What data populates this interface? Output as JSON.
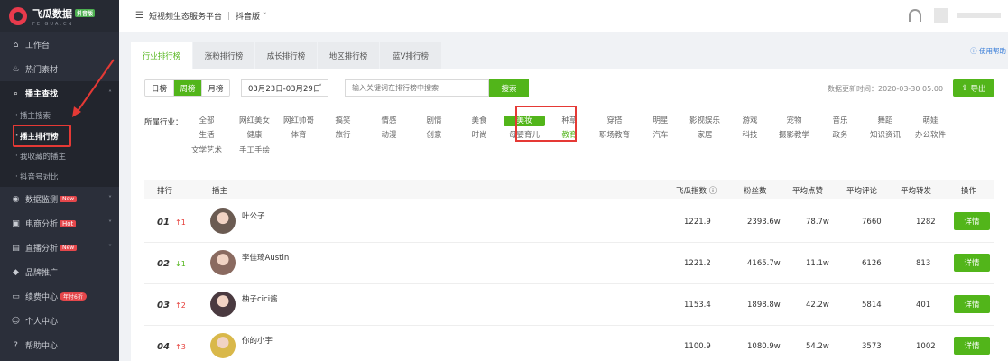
{
  "brand": {
    "name": "飞瓜数据",
    "badge": "抖音版",
    "sub": "FEIGUA.CN"
  },
  "sidebar": {
    "items": [
      {
        "label": "工作台",
        "icon": "home-icon"
      },
      {
        "label": "热门素材",
        "icon": "fire-icon"
      },
      {
        "label": "播主查找",
        "icon": "search-icon"
      },
      {
        "label": "数据监测",
        "icon": "monitor-icon",
        "tag": "New"
      },
      {
        "label": "电商分析",
        "icon": "cart-icon",
        "tag": "Hot"
      },
      {
        "label": "直播分析",
        "icon": "live-icon",
        "tag": "New"
      },
      {
        "label": "品牌推广",
        "icon": "diamond-icon"
      },
      {
        "label": "续费中心",
        "icon": "card-icon",
        "tag": "年付6折"
      },
      {
        "label": "个人中心",
        "icon": "user-icon"
      },
      {
        "label": "帮助中心",
        "icon": "help-icon"
      }
    ],
    "sub_items": [
      "播主搜索",
      "播主排行榜",
      "我收藏的播主",
      "抖音号对比"
    ]
  },
  "header": {
    "title": "短视频生态服务平台",
    "version": "抖音版"
  },
  "tabs": [
    "行业排行榜",
    "涨粉排行榜",
    "成长排行榜",
    "地区排行榜",
    "蓝V排行榜"
  ],
  "help_link": "使用帮助",
  "toolbar": {
    "periods": [
      "日榜",
      "周榜",
      "月榜"
    ],
    "date_range": "03月23日-03月29日",
    "search_placeholder": "输入关键词在排行榜中搜索",
    "search_label": "搜索",
    "update_time": "数据更新时间：2020-03-30 05:00",
    "export_label": "导出"
  },
  "industry": {
    "label": "所属行业：",
    "rows": [
      [
        "全部",
        "网红美女",
        "网红帅哥",
        "搞笑",
        "情感",
        "剧情",
        "美食",
        "美妆",
        "种草",
        "穿搭",
        "明星",
        "影视娱乐",
        "游戏",
        "宠物",
        "音乐",
        "舞蹈",
        "萌娃"
      ],
      [
        "生活",
        "健康",
        "体育",
        "旅行",
        "动漫",
        "创意",
        "时尚",
        "母婴育儿",
        "教育",
        "职场教育",
        "汽车",
        "家居",
        "科技",
        "摄影教学",
        "政务",
        "知识资讯",
        "办公软件"
      ],
      [
        "文学艺术",
        "手工手绘"
      ]
    ],
    "selected": "美妆"
  },
  "table": {
    "headers": [
      "排行",
      "播主",
      "飞瓜指数",
      "粉丝数",
      "平均点赞",
      "平均评论",
      "平均转发",
      "操作"
    ],
    "detail_label": "详情",
    "rows": [
      {
        "rank": "01",
        "trend": "↑1",
        "dir": "up",
        "name": "叶公子",
        "index": "1221.9",
        "fans": "2393.6w",
        "likes": "78.7w",
        "comments": "7660",
        "shares": "1282"
      },
      {
        "rank": "02",
        "trend": "↓1",
        "dir": "down",
        "name": "李佳琦Austin",
        "index": "1221.2",
        "fans": "4165.7w",
        "likes": "11.1w",
        "comments": "6126",
        "shares": "813"
      },
      {
        "rank": "03",
        "trend": "↑2",
        "dir": "up",
        "name": "柚子cici酱",
        "index": "1153.4",
        "fans": "1898.8w",
        "likes": "42.2w",
        "comments": "5814",
        "shares": "401"
      },
      {
        "rank": "04",
        "trend": "↑3",
        "dir": "up",
        "name": "你的小宇",
        "index": "1100.9",
        "fans": "1080.9w",
        "likes": "54.2w",
        "comments": "3573",
        "shares": "1002"
      }
    ]
  },
  "colors": {
    "accent": "#52b51a",
    "sidebar_bg": "#2b2f3a",
    "highlight": "#e53935"
  }
}
